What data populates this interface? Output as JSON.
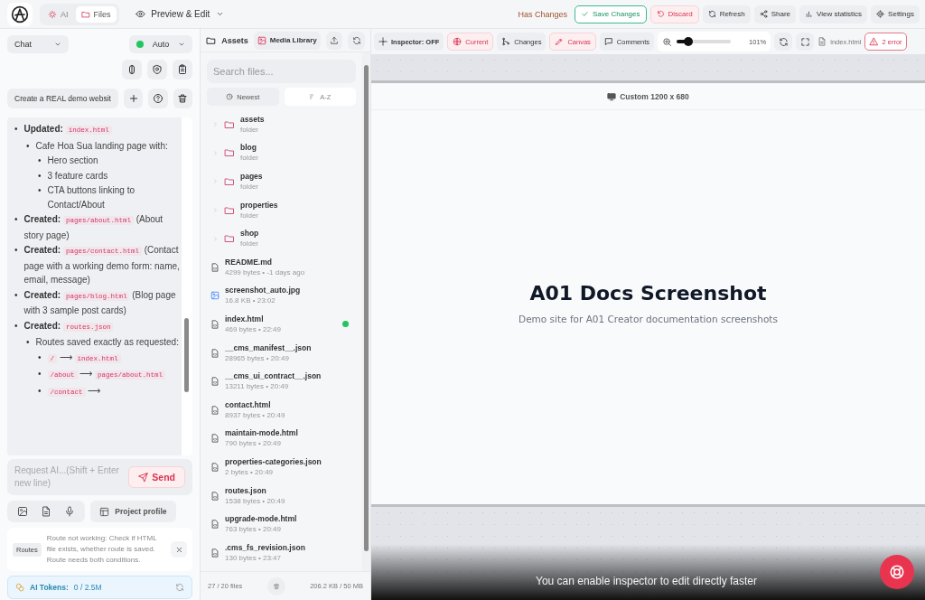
{
  "header": {
    "mode_tabs": [
      {
        "label": "AI",
        "selected": false
      },
      {
        "label": "Files",
        "selected": true
      }
    ],
    "view_menu": "Preview & Edit",
    "status": "Has Changes",
    "actions": [
      {
        "kind": "success",
        "label": "Save Changes"
      },
      {
        "kind": "danger",
        "label": "Discard"
      },
      {
        "kind": "plain",
        "label": "Refresh"
      },
      {
        "kind": "plain",
        "label": "Share"
      },
      {
        "kind": "plain",
        "label": "View statistics"
      },
      {
        "kind": "plain",
        "label": "Settings"
      }
    ]
  },
  "chat": {
    "mode_select": "Chat",
    "model_select": {
      "label": "Auto",
      "color": "#22c55e"
    },
    "session": "Create a REAL demo websit",
    "messages": [
      {
        "marker": "•",
        "parts": [
          {
            "kind": "bold",
            "text": "Updated:"
          },
          {
            "kind": "code",
            "text": "index.html"
          }
        ],
        "children": [
          {
            "marker": "•",
            "parts": [
              {
                "kind": "text",
                "text": "Cafe Hoa Sua landing page with:"
              }
            ],
            "children": [
              {
                "marker": "•",
                "parts": [
                  {
                    "kind": "text",
                    "text": "Hero section"
                  }
                ]
              },
              {
                "marker": "•",
                "parts": [
                  {
                    "kind": "text",
                    "text": "3 feature cards"
                  }
                ]
              },
              {
                "marker": "•",
                "parts": [
                  {
                    "kind": "text",
                    "text": "CTA buttons linking to Contact/About"
                  }
                ]
              }
            ]
          }
        ]
      },
      {
        "marker": "•",
        "parts": [
          {
            "kind": "bold",
            "text": "Created:"
          },
          {
            "kind": "code",
            "text": "pages/about.html"
          },
          {
            "kind": "text",
            "text": "(About story page)"
          }
        ]
      },
      {
        "marker": "•",
        "parts": [
          {
            "kind": "bold",
            "text": "Created:"
          },
          {
            "kind": "code",
            "text": "pages/contact.html"
          },
          {
            "kind": "text",
            "text": "(Contact page with a working demo form: name, email, message)"
          }
        ]
      },
      {
        "marker": "•",
        "parts": [
          {
            "kind": "bold",
            "text": "Created:"
          },
          {
            "kind": "code",
            "text": "pages/blog.html"
          },
          {
            "kind": "text",
            "text": "(Blog page with 3 sample post cards)"
          }
        ]
      },
      {
        "marker": "•",
        "parts": [
          {
            "kind": "bold",
            "text": "Created:"
          },
          {
            "kind": "code",
            "text": "routes.json"
          }
        ],
        "children": [
          {
            "marker": "•",
            "parts": [
              {
                "kind": "text",
                "text": "Routes saved exactly as requested:"
              }
            ],
            "children": [
              {
                "marker": "•",
                "parts": [
                  {
                    "kind": "code",
                    "text": "/"
                  },
                  {
                    "kind": "arrow",
                    "text": "⟶"
                  },
                  {
                    "kind": "code",
                    "text": "index.html"
                  }
                ]
              },
              {
                "marker": "•",
                "parts": [
                  {
                    "kind": "code",
                    "text": "/about"
                  },
                  {
                    "kind": "arrow",
                    "text": "⟶"
                  },
                  {
                    "kind": "code",
                    "text": "pages/about.html"
                  }
                ]
              },
              {
                "marker": "•",
                "parts": [
                  {
                    "kind": "code",
                    "text": "/contact"
                  },
                  {
                    "kind": "arrow",
                    "text": "⟶"
                  }
                ]
              }
            ]
          }
        ]
      }
    ],
    "composer": {
      "placeholder": "Request AI...(Shift + Enter new line)",
      "send": "Send"
    },
    "project_profile": "Project profile",
    "notice": {
      "tag": "Routes",
      "text": "Route not working: Check if HTML file exists, whether route is saved. Route needs both conditions."
    },
    "tokens": {
      "label": "AI Tokens:",
      "value": "0 / 2.5M"
    }
  },
  "files": {
    "title": "Assets",
    "media_library": "Media Library",
    "search": {
      "placeholder": "Search files..."
    },
    "sort": [
      {
        "label": "Newest",
        "selected": false
      },
      {
        "label": "A-Z",
        "selected": true
      }
    ],
    "items": [
      {
        "kind": "folder",
        "name": "assets",
        "meta": "folder"
      },
      {
        "kind": "folder",
        "name": "blog",
        "meta": "folder"
      },
      {
        "kind": "folder",
        "name": "pages",
        "meta": "folder"
      },
      {
        "kind": "folder",
        "name": "properties",
        "meta": "folder"
      },
      {
        "kind": "folder",
        "name": "shop",
        "meta": "folder"
      },
      {
        "kind": "file",
        "name": "README.md",
        "meta": "4299 bytes • -1 days ago",
        "modified": false
      },
      {
        "kind": "image",
        "name": "screenshot_auto.jpg",
        "meta": "16.8 KB • 23:02",
        "modified": false
      },
      {
        "kind": "file",
        "name": "index.html",
        "meta": "469 bytes • 22:49",
        "modified": true
      },
      {
        "kind": "file",
        "name": "__cms_manifest__.json",
        "meta": "28965 bytes • 20:49",
        "modified": false
      },
      {
        "kind": "file",
        "name": "__cms_ui_contract__.json",
        "meta": "13211 bytes • 20:49",
        "modified": false
      },
      {
        "kind": "file",
        "name": "contact.html",
        "meta": "8937 bytes • 20:49",
        "modified": false
      },
      {
        "kind": "file",
        "name": "maintain-mode.html",
        "meta": "790 bytes • 20:49",
        "modified": false
      },
      {
        "kind": "file",
        "name": "properties-categories.json",
        "meta": "2 bytes • 20:49",
        "modified": false
      },
      {
        "kind": "file",
        "name": "routes.json",
        "meta": "1538 bytes • 20:49",
        "modified": false
      },
      {
        "kind": "file",
        "name": "upgrade-mode.html",
        "meta": "763 bytes • 20:49",
        "modified": false
      },
      {
        "kind": "file",
        "name": ".cms_fs_revision.json",
        "meta": "130 bytes • 23:47",
        "modified": false
      }
    ],
    "count": "27 / 20 files",
    "usage": "206.2 KB / 50 MB"
  },
  "toolbar": {
    "tools": [
      {
        "kind": "plain",
        "label": "Inspector: OFF"
      },
      {
        "kind": "accent",
        "label": "Current"
      },
      {
        "kind": "plain",
        "label": "Changes"
      },
      {
        "kind": "accent",
        "label": "Canvas"
      },
      {
        "kind": "plain",
        "label": "Comments"
      }
    ],
    "zoom": {
      "level": 0.22,
      "reading": "101%"
    },
    "file": "index.html",
    "errors": "2 error"
  },
  "preview": {
    "viewport": "Custom 1200 x 680",
    "heading": "A01 Docs Screenshot",
    "subtitle": "Demo site for A01 Creator documentation screenshots",
    "hint": "You can enable inspector to edit directly faster"
  }
}
